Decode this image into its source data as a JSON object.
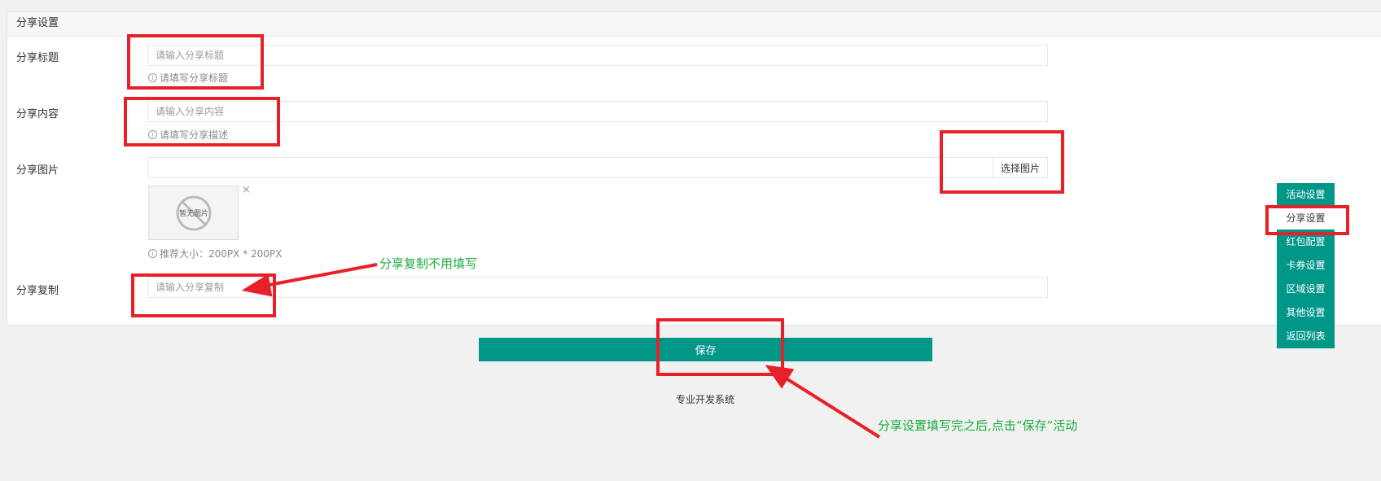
{
  "panel": {
    "title": "分享设置"
  },
  "form": {
    "title": {
      "label": "分享标题",
      "placeholder": "请输入分享标题",
      "help": "请填写分享标题"
    },
    "content": {
      "label": "分享内容",
      "placeholder": "请输入分享内容",
      "help": "请填写分享描述"
    },
    "image": {
      "label": "分享图片",
      "button": "选择图片",
      "no_image": "暂无图片",
      "close": "×",
      "help": "推荐大小：200PX * 200PX"
    },
    "copy": {
      "label": "分享复制",
      "placeholder": "请输入分享复制"
    }
  },
  "info_glyph": "i",
  "nav": {
    "items": [
      "活动设置",
      "分享设置",
      "红包配置",
      "卡券设置",
      "区域设置",
      "其他设置",
      "返回列表"
    ],
    "active_index": 1
  },
  "save_label": "保存",
  "footer": "专业开发系统",
  "annotations": {
    "copy_note": "分享复制不用填写",
    "save_note": "分享设置填写完之后,点击“保存”活动"
  },
  "colors": {
    "accent": "#009688",
    "annotation_red": "#e8202a",
    "annotation_green": "#1aad3c"
  }
}
